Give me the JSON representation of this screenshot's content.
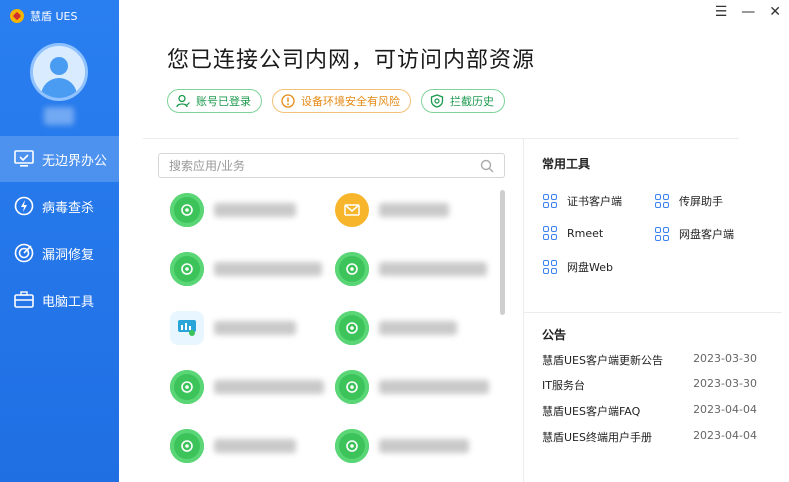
{
  "app": {
    "brand": "慧盾 UES"
  },
  "window": {
    "menu_glyph": "☰",
    "minimize_glyph": "—",
    "close_glyph": "✕"
  },
  "sidebar": {
    "items": [
      {
        "label": "无边界办公",
        "icon": "monitor-icon",
        "active": true
      },
      {
        "label": "病毒查杀",
        "icon": "lightning-icon",
        "active": false
      },
      {
        "label": "漏洞修复",
        "icon": "target-icon",
        "active": false
      },
      {
        "label": "电脑工具",
        "icon": "toolbox-icon",
        "active": false
      }
    ]
  },
  "header": {
    "title": "您已连接公司内网，可访问内部资源",
    "status": [
      {
        "label": "账号已登录",
        "color": "green",
        "icon": "user-icon"
      },
      {
        "label": "设备环境安全有风险",
        "color": "orange",
        "icon": "warning-icon"
      },
      {
        "label": "拦截历史",
        "color": "green",
        "icon": "shield-icon"
      }
    ]
  },
  "search": {
    "placeholder": "搜索应用/业务",
    "value": ""
  },
  "tools": {
    "title": "常用工具",
    "items": [
      "证书客户端",
      "传屏助手",
      "Rmeet",
      "网盘客户端",
      "网盘Web"
    ]
  },
  "announcements": {
    "title": "公告",
    "items": [
      {
        "title": "慧盾UES客户端更新公告",
        "date": "2023-03-30"
      },
      {
        "title": "IT服务台",
        "date": "2023-03-30"
      },
      {
        "title": "慧盾UES客户端FAQ",
        "date": "2023-04-04"
      },
      {
        "title": "慧盾UES终端用户手册",
        "date": "2023-04-04"
      }
    ]
  },
  "colors": {
    "sidebar": "#1f6fe3",
    "accent_green": "#3cc35a",
    "accent_orange": "#e58a16",
    "tool_icon": "#3a82f0"
  }
}
